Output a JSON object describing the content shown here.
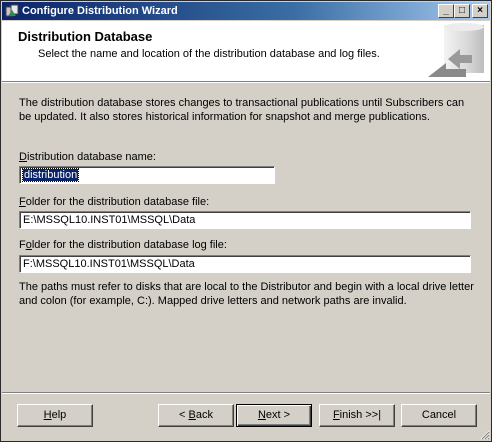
{
  "window": {
    "title": "Configure Distribution Wizard",
    "controls": {
      "minimize": "_",
      "maximize": "□",
      "close": "×"
    }
  },
  "header": {
    "title": "Distribution Database",
    "subtitle": "Select the name and location of the distribution database and log files.",
    "graphic": "server-cylinder-icon"
  },
  "intro_text": "The distribution database stores changes to transactional publications until Subscribers can be updated. It also stores historical information for snapshot and merge publications.",
  "fields": {
    "db_name": {
      "label_accel": "D",
      "label_rest": "istribution database name:",
      "value": "distribution"
    },
    "data_folder": {
      "label_accel": "F",
      "label_rest": "older for the distribution database file:",
      "value": "E:\\MSSQL10.INST01\\MSSQL\\Data"
    },
    "log_folder": {
      "label_pre": "F",
      "label_accel": "o",
      "label_rest": "lder for the distribution database log file:",
      "value": "F:\\MSSQL10.INST01\\MSSQL\\Data"
    }
  },
  "note_text": "The paths must refer to disks that are local to the Distributor and begin with a local drive letter and colon (for example, C:). Mapped drive letters and network paths are invalid.",
  "buttons": {
    "help": {
      "accel": "H",
      "rest": "elp"
    },
    "back": {
      "pre": "< ",
      "accel": "B",
      "rest": "ack"
    },
    "next": {
      "accel": "N",
      "rest": "ext >"
    },
    "finish": {
      "accel": "F",
      "rest": "inish >>|"
    },
    "cancel": {
      "label": "Cancel"
    }
  },
  "colors": {
    "titlebar_start": "#0a246a",
    "titlebar_end": "#a6caf0",
    "dialog_face": "#d4d0c8",
    "selection": "#0a246a"
  }
}
